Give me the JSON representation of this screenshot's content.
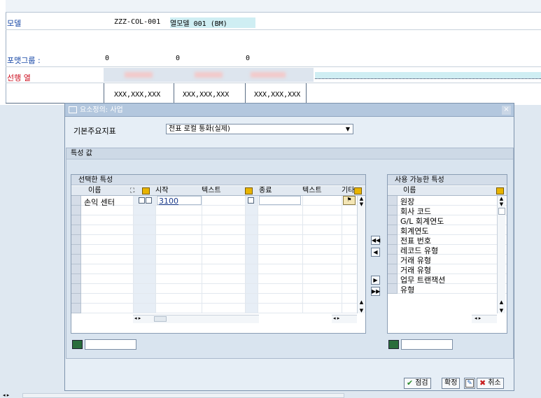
{
  "background": {
    "model_label": "모델",
    "model_code": "ZZZ-COL-001",
    "model_name": "열모델 001 (BM)",
    "format_group_label": "포맷그룹 :",
    "format_group_values": [
      "0",
      "0",
      "0"
    ],
    "lead_column_label": "선행 열",
    "xxx_values": [
      "XXX,XXX,XXX",
      "XXX,XXX,XXX",
      "XXX,XXX,XXX"
    ]
  },
  "dialog": {
    "title": "요소정의: 사업",
    "kpi_label": "기본주요지표",
    "kpi_value": "전표 로컬 통화(실제)",
    "group_title": "특성 값",
    "selected": {
      "title": "선택한 특성",
      "columns": [
        "이름",
        "시작",
        "텍스트",
        "종료",
        "텍스트",
        "기타"
      ],
      "rows": [
        {
          "name": "손익 센터",
          "from": "3100"
        }
      ]
    },
    "available": {
      "title": "사용 가능한 특성",
      "column": "이름",
      "items": [
        "원장",
        "회사 코드",
        "G/L 회계연도",
        "회계연도",
        "전표 번호",
        "레코드 유형",
        "거래 유형",
        "거래 유형",
        "업무 트랜잭션",
        "유형"
      ]
    },
    "buttons": {
      "check": "점검",
      "confirm": "확정",
      "cancel": "취소"
    }
  }
}
